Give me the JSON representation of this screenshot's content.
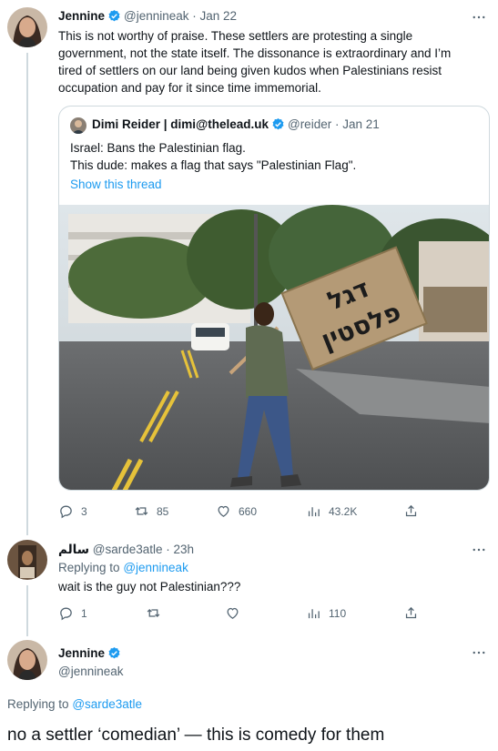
{
  "tweet1": {
    "name": "Jennine",
    "handle": "@jennineak",
    "date": "Jan 22",
    "text": "This is not worthy of praise. These settlers are protesting a single government, not the state itself. The dissonance is extraordinary and I’m tired of settlers on our land being given kudos when Palestinians resist occupation and pay for it since time immemorial.",
    "stats": {
      "replies": "3",
      "retweets": "85",
      "likes": "660",
      "views": "43.2K"
    }
  },
  "quote": {
    "name": "Dimi Reider | dimi@thelead.uk",
    "handle": "@reider",
    "date": "Jan 21",
    "line1": "Israel: Bans the Palestinian flag.",
    "line2": "This dude: makes a flag that says \"Palestinian Flag\".",
    "show_thread": "Show this thread",
    "sign_line1": "דגל",
    "sign_line2": "פלסטין"
  },
  "tweet2": {
    "name": "سالم",
    "handle": "@sarde3atle",
    "date": "23h",
    "replying_label": "Replying to",
    "replying_to": "@jennineak",
    "text": "wait is the guy not Palestinian???",
    "stats": {
      "replies": "1",
      "retweets": "",
      "likes": "",
      "views": "110"
    }
  },
  "tweet3": {
    "name": "Jennine",
    "handle": "@jennineak",
    "replying_label": "Replying to",
    "replying_to": "@sarde3atle",
    "text": "no a settler ‘comedian’ — this is comedy for them"
  },
  "colors": {
    "accent": "#1d9bf0",
    "muted": "#536471",
    "border": "#cfd9de"
  },
  "icons": [
    "verified-icon",
    "more-icon",
    "reply-icon",
    "retweet-icon",
    "like-icon",
    "views-icon",
    "share-icon"
  ]
}
